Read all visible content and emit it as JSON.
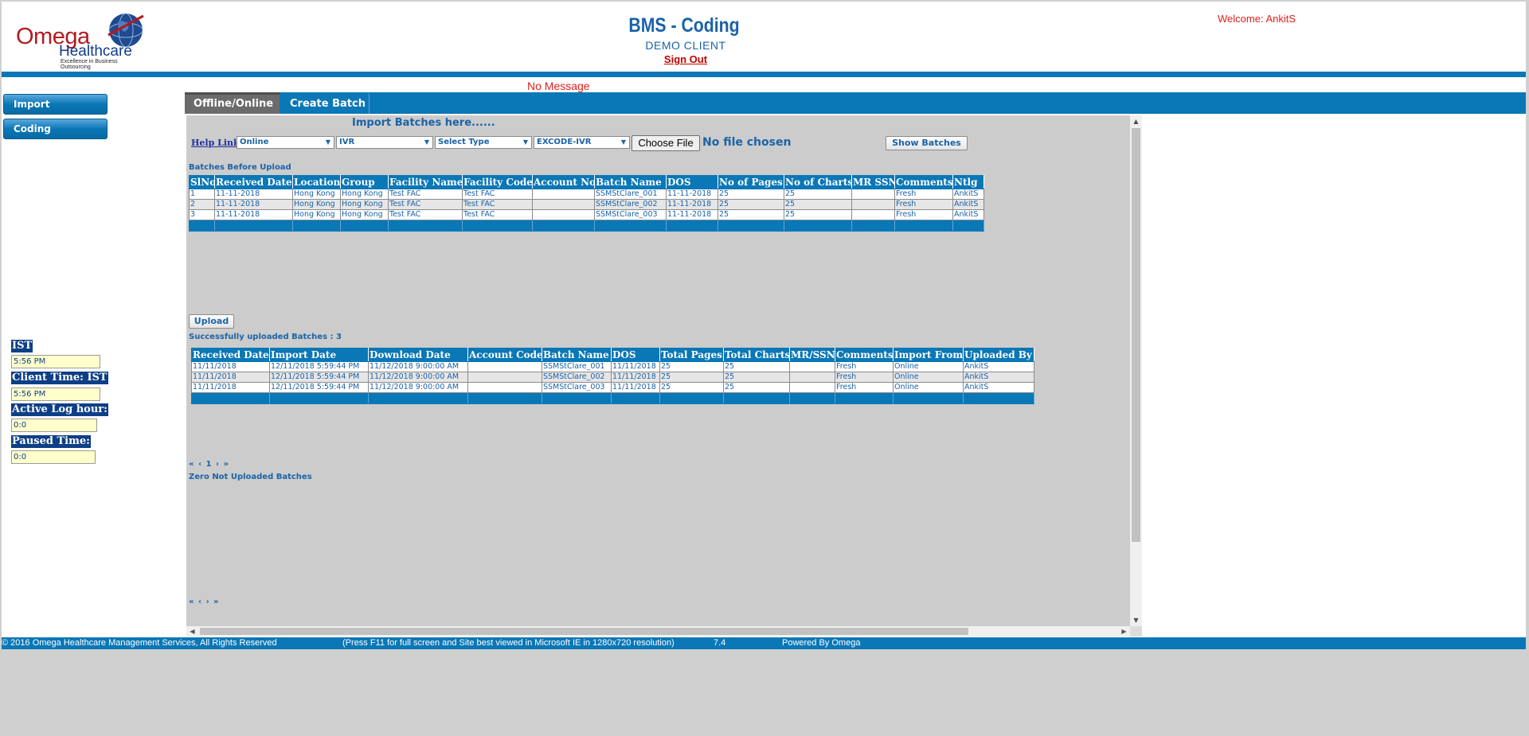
{
  "header": {
    "logo_word1": "Omega",
    "logo_word2": "Healthcare",
    "logo_tagline": "Excellence in Business Outsourcing",
    "app_title": "BMS - Coding",
    "client_name": "DEMO CLIENT",
    "sign_out": "Sign Out",
    "welcome": "Welcome: AnkitS",
    "message": "No Message"
  },
  "nav": {
    "import_label": "Import",
    "coding_label": "Coding"
  },
  "clock": {
    "ist_label": "IST",
    "ist_value": "5:56 PM",
    "client_time_label": "Client Time: IST",
    "client_time_value": "5:56 PM",
    "active_log_label": "Active Log hour:",
    "active_log_value": "0:0",
    "paused_label": "Paused Time:",
    "paused_value": "0:0"
  },
  "tabs": [
    {
      "label": "Offline/Online",
      "active": true
    },
    {
      "label": "Create Batch",
      "active": false
    }
  ],
  "import_panel": {
    "heading": "Import Batches here......",
    "help_link": "Help Link",
    "mode_select": "Online",
    "source_select": "IVR",
    "type_select": "Select Type",
    "profile_select": "EXCODE-IVR",
    "choose_file": "Choose File",
    "no_file": "No file chosen",
    "show_batches": "Show Batches",
    "upload": "Upload"
  },
  "before_upload": {
    "title": "Batches Before Upload",
    "columns": [
      "SlNo",
      "Received Date",
      "Location",
      "Group",
      "Facility Name",
      "Facility Code",
      "Account No",
      "Batch Name",
      "DOS",
      "No of Pages",
      "No of Charts",
      "MR SSN",
      "Comments",
      "Ntlg"
    ],
    "rows": [
      [
        "1",
        "11-11-2018",
        "Hong Kong",
        "Hong Kong",
        "Test FAC",
        "Test FAC",
        "",
        "SSMStClare_001",
        "11-11-2018",
        "25",
        "25",
        "",
        "Fresh",
        "AnkitS"
      ],
      [
        "2",
        "11-11-2018",
        "Hong Kong",
        "Hong Kong",
        "Test FAC",
        "Test FAC",
        "",
        "SSMStClare_002",
        "11-11-2018",
        "25",
        "25",
        "",
        "Fresh",
        "AnkitS"
      ],
      [
        "3",
        "11-11-2018",
        "Hong Kong",
        "Hong Kong",
        "Test FAC",
        "Test FAC",
        "",
        "SSMStClare_003",
        "11-11-2018",
        "25",
        "25",
        "",
        "Fresh",
        "AnkitS"
      ]
    ]
  },
  "uploaded": {
    "title": "Successfully uploaded Batches : 3",
    "columns": [
      "Received Date",
      "Import Date",
      "Download Date",
      "Account Code",
      "Batch Name",
      "DOS",
      "Total Pages",
      "Total Charts",
      "MR/SSN",
      "Comments",
      "Import From",
      "Uploaded By"
    ],
    "rows": [
      [
        "11/11/2018",
        "12/11/2018 5:59:44 PM",
        "11/12/2018 9:00:00 AM",
        "",
        "SSMStClare_001",
        "11/11/2018",
        "25",
        "25",
        "",
        "Fresh",
        "Online",
        "AnkitS"
      ],
      [
        "11/11/2018",
        "12/11/2018 5:59:44 PM",
        "11/12/2018 9:00:00 AM",
        "",
        "SSMStClare_002",
        "11/11/2018",
        "25",
        "25",
        "",
        "Fresh",
        "Online",
        "AnkitS"
      ],
      [
        "11/11/2018",
        "12/11/2018 5:59:44 PM",
        "11/12/2018 9:00:00 AM",
        "",
        "SSMStClare_003",
        "11/11/2018",
        "25",
        "25",
        "",
        "Fresh",
        "Online",
        "AnkitS"
      ]
    ],
    "pager": {
      "first": "«",
      "prev": "‹",
      "page": "1",
      "next": "›",
      "last": "»"
    }
  },
  "not_uploaded": {
    "title": "Zero Not Uploaded Batches",
    "pager": {
      "first": "«",
      "prev": "‹",
      "next": "›",
      "last": "»"
    }
  },
  "footer": {
    "copyright": "© 2016 Omega Healthcare Management Services, All Rights Reserved",
    "note": "(Press F11 for full screen and Site best viewed in Microsoft IE in 1280x720 resolution)",
    "version": "7.4",
    "powered": "Powered By Omega"
  },
  "colors": {
    "brand_blue": "#0a77b6",
    "text_blue": "#1a63a8",
    "alert_red": "#e0201a",
    "logo_red": "#b31a1f",
    "panel_gray": "#cccccc"
  },
  "icons": {
    "select_caret": "▼",
    "scroll_up": "▲",
    "scroll_down": "▼",
    "scroll_left": "◀",
    "scroll_right": "▶"
  }
}
